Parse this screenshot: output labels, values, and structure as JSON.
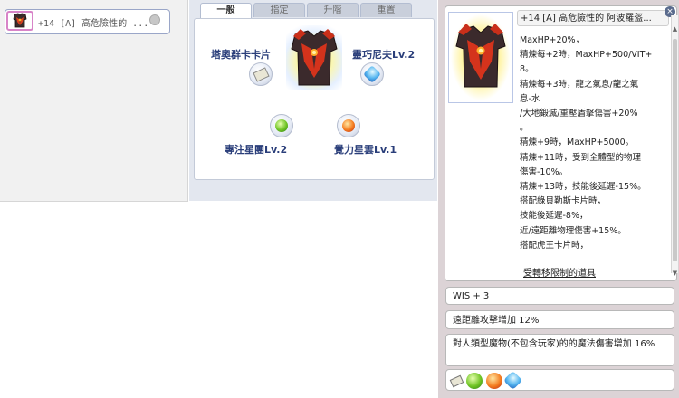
{
  "item_slot": {
    "name": "+14 [A] 高危險性的 ...",
    "icon": "armor-icon"
  },
  "card_panel": {
    "tabs": [
      {
        "label": "一般",
        "active": true
      },
      {
        "label": "指定",
        "active": false
      },
      {
        "label": "升階",
        "active": false
      },
      {
        "label": "重置",
        "active": false
      }
    ],
    "slots": {
      "top_left": "塔奧群卡卡片",
      "top_right": "靈巧尼夫Lv.2",
      "bottom_left": "專注星團Lv.2",
      "bottom_right": "覺力星雲Lv.1"
    }
  },
  "info": {
    "title": "+14 [A] 高危險性的 阿波羅盔...",
    "close": "×",
    "description": [
      "MaxHP+20%，",
      "精煉每+2時，MaxHP+500/VIT+",
      "8。",
      "精煉每+3時，龍之氣息/龍之氣",
      "息-水",
      "/大地鍛滅/重壓盾擊傷害+20%",
      "。",
      "精煉+9時，MaxHP+5000。",
      "精煉+11時，受到全體型的物理",
      "傷害-10%。",
      "精煉+13時，技能後延遲-15%。",
      "搭配綠貝勒斯卡片時，",
      "技能後延遲-8%，",
      "近/遠距離物理傷害+15%。",
      "搭配虎王卡片時，"
    ],
    "restriction_link": "受轉移限制的道具",
    "options": [
      "WIS + 3",
      "遠距離攻擊增加 12%",
      "對人類型魔物(不包含玩家)的的魔法傷害增加 16%"
    ]
  },
  "colors": {
    "tab_active": "#ffffff",
    "tab_inactive": "#c9cfdb",
    "card_label": "#2a3e7a",
    "window_bg": "#dcd3d6"
  }
}
